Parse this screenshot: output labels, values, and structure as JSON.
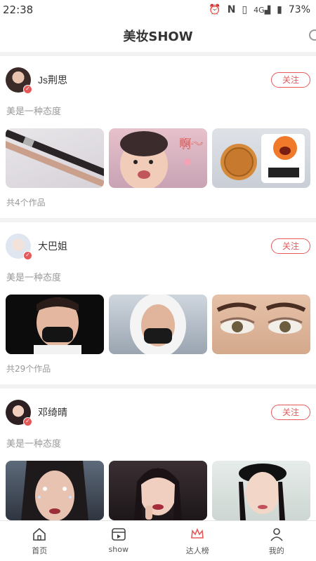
{
  "status_bar": {
    "time": "22:38",
    "battery": "73%",
    "network": "4G",
    "icons": [
      "alarm-icon",
      "nfc-icon",
      "vibrate-icon",
      "signal-icon",
      "battery-icon"
    ]
  },
  "header": {
    "title": "美妆SHOW",
    "search_icon": "search-icon"
  },
  "cards": [
    {
      "name": "Js荆思",
      "follow_label": "关注",
      "motto": "美是一种态度",
      "works": "共4个作品",
      "thumbs": [
        "pens-photo",
        "baby-photo",
        "mooncake-photo"
      ]
    },
    {
      "name": "大巴姐",
      "follow_label": "关注",
      "motto": "美是一种态度",
      "works": "共29个作品",
      "thumbs": [
        "selfie-mask-photo",
        "hood-mask-photo",
        "eye-makeup-photo"
      ]
    },
    {
      "name": "邓绮晴",
      "follow_label": "关注",
      "motto": "美是一种态度",
      "works": "",
      "thumbs": [
        "glitter-makeup-photo",
        "woman-portrait-photo",
        "beret-portrait-photo"
      ]
    }
  ],
  "tabbar": {
    "items": [
      {
        "label": "首页",
        "icon": "home-icon"
      },
      {
        "label": "show",
        "icon": "video-icon"
      },
      {
        "label": "达人榜",
        "icon": "crown-icon"
      },
      {
        "label": "我的",
        "icon": "person-icon"
      }
    ]
  },
  "colors": {
    "accent": "#e5595a",
    "muted": "#999999"
  }
}
